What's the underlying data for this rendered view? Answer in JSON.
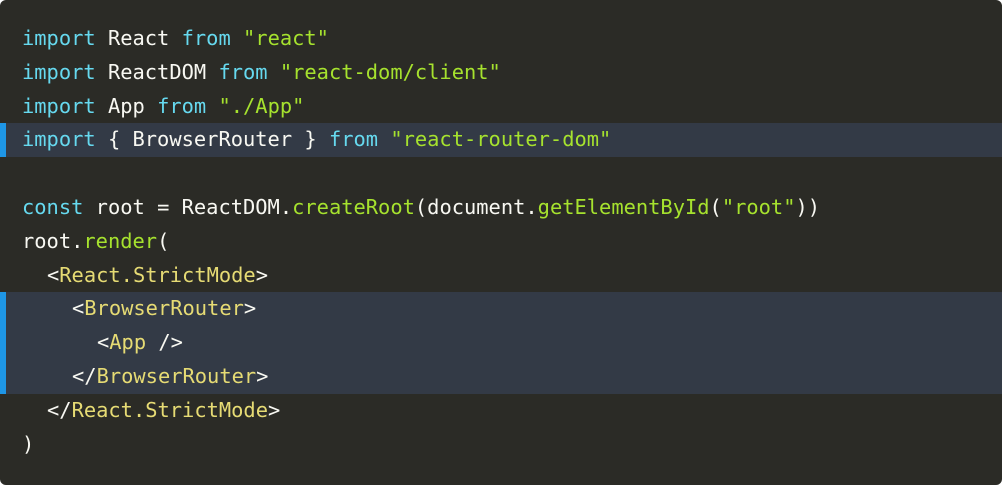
{
  "code": {
    "line1": {
      "kw1": "import",
      "id": "React",
      "kw2": "from",
      "src": "\"react\""
    },
    "line2": {
      "kw1": "import",
      "id": "ReactDOM",
      "kw2": "from",
      "src": "\"react-dom/client\""
    },
    "line3": {
      "kw1": "import",
      "id": "App",
      "kw2": "from",
      "src": "\"./App\""
    },
    "line4": {
      "kw1": "import",
      "id": "{ BrowserRouter }",
      "kw2": "from",
      "src": "\"react-router-dom\""
    },
    "line6": {
      "kw": "const",
      "var": "root",
      "eq": "=",
      "obj": "ReactDOM",
      "dot1": ".",
      "method": "createRoot",
      "open": "(",
      "doc": "document",
      "dot2": ".",
      "method2": "getElementById",
      "open2": "(",
      "arg": "\"root\"",
      "close": "))"
    },
    "line7": {
      "obj": "root",
      "dot": ".",
      "method": "render",
      "open": "("
    },
    "line8": {
      "lt": "<",
      "tag": "React.StrictMode",
      "gt": ">"
    },
    "line9": {
      "lt": "<",
      "tag": "BrowserRouter",
      "gt": ">"
    },
    "line10": {
      "lt": "<",
      "tag": "App",
      "gt": " />"
    },
    "line11": {
      "lt": "</",
      "tag": "BrowserRouter",
      "gt": ">"
    },
    "line12": {
      "lt": "</",
      "tag": "React.StrictMode",
      "gt": ">"
    },
    "line13": {
      "close": ")"
    }
  },
  "colors": {
    "background": "#2b2b26",
    "highlight_background": "#333a46",
    "highlight_bar": "#1e96e6",
    "keyword": "#66d9ef",
    "string": "#a6e22e",
    "function": "#a6e22e",
    "jsx_tag": "#e6db74",
    "text": "#f8f8f2"
  },
  "highlighted_lines": [
    4,
    9,
    10,
    11
  ]
}
